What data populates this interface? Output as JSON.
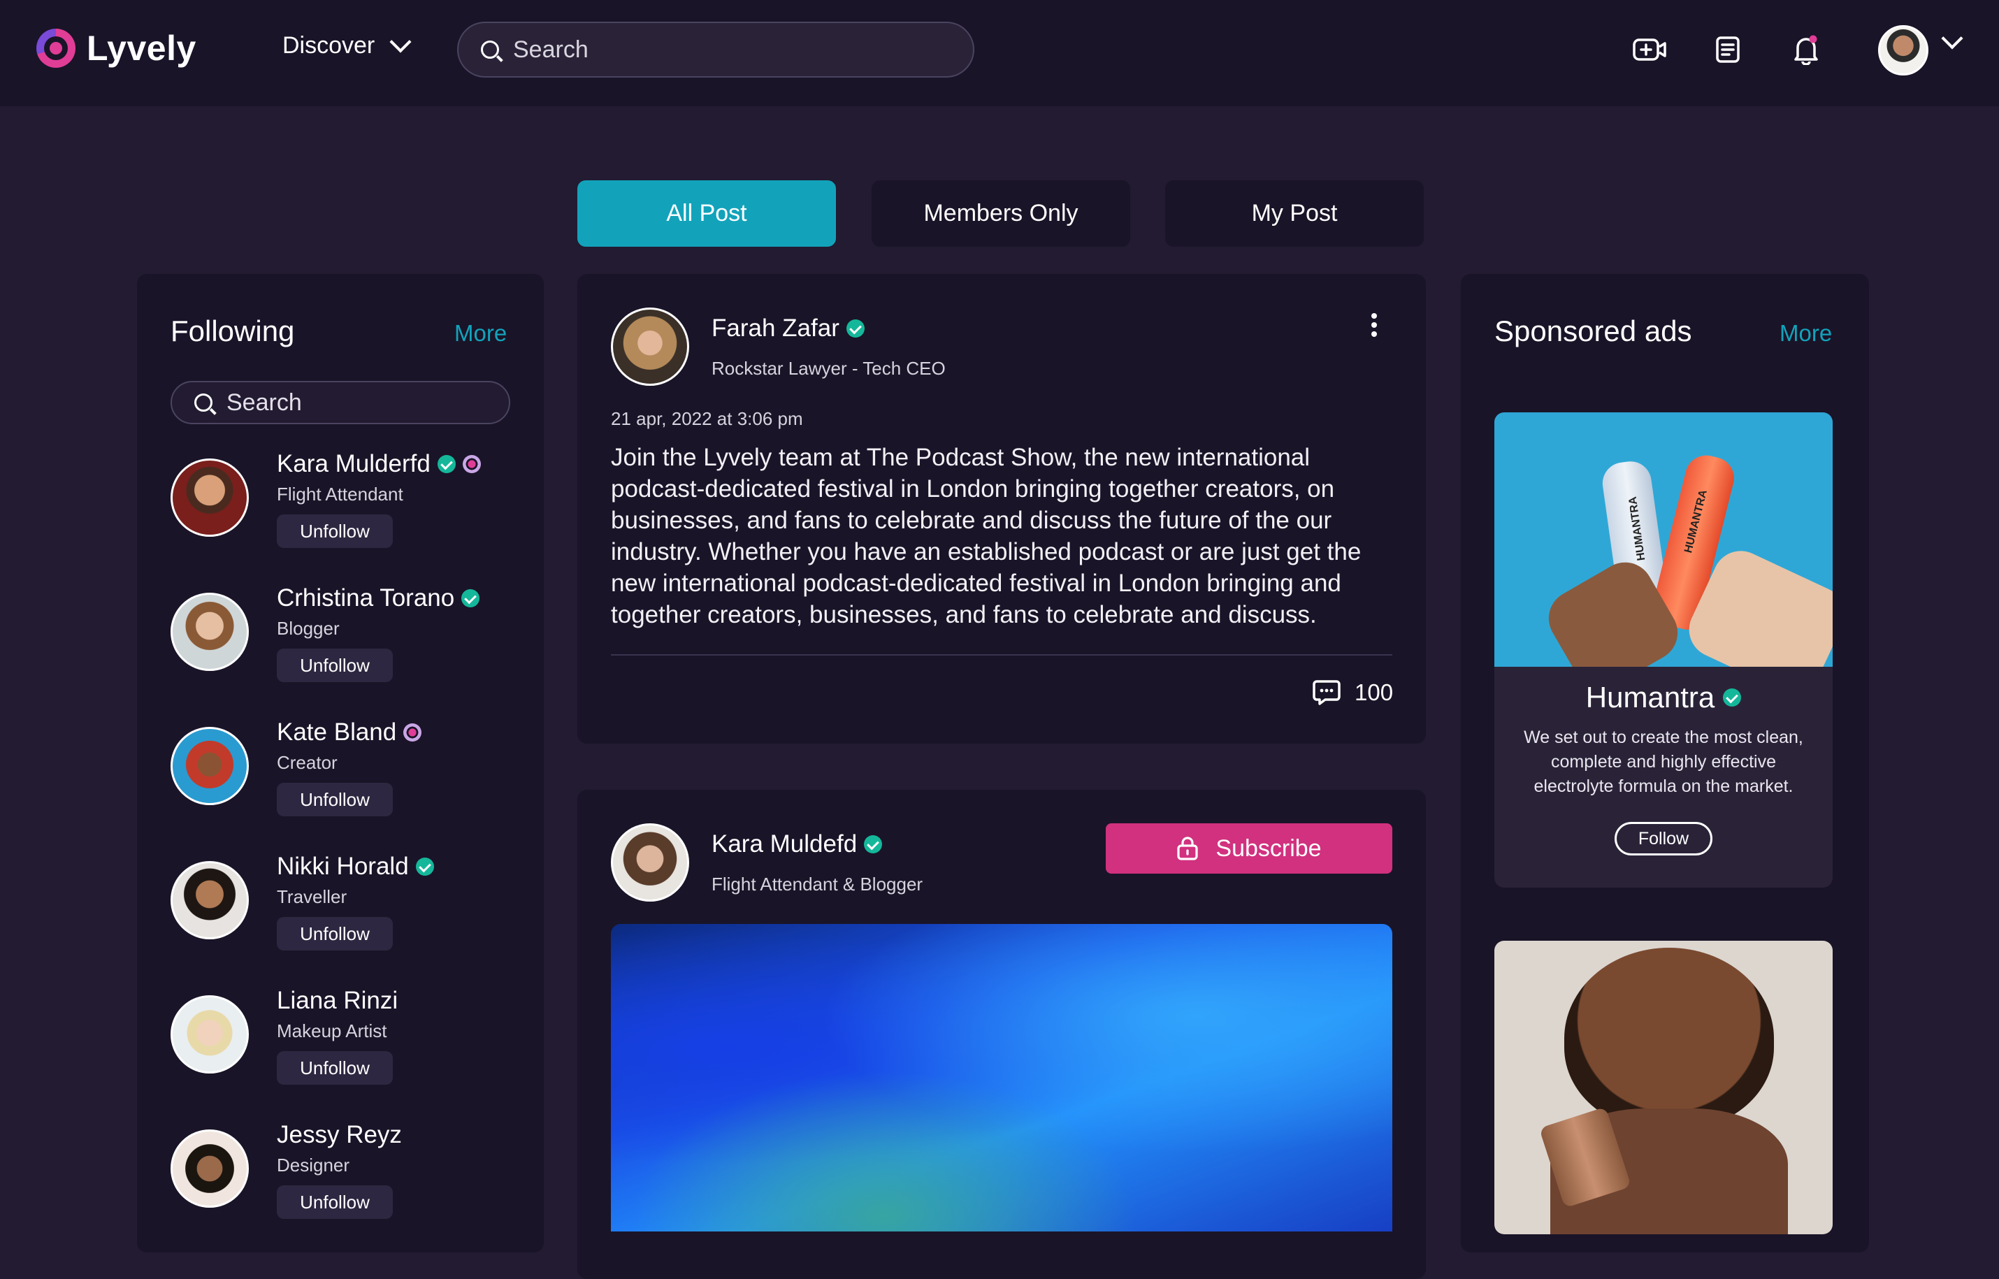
{
  "app": {
    "name": "Lyvely",
    "accent": "#12a3bb",
    "brand": "#e03d97"
  },
  "header": {
    "discover_label": "Discover",
    "search_placeholder": "Search",
    "icons": [
      "add-video-icon",
      "document-icon",
      "bell-icon"
    ],
    "has_notification": true
  },
  "tabs": [
    {
      "label": "All Post",
      "active": true
    },
    {
      "label": "Members Only",
      "active": false
    },
    {
      "label": "My Post",
      "active": false
    }
  ],
  "following": {
    "title": "Following",
    "more": "More",
    "search_placeholder": "Search",
    "unfollow_label": "Unfollow",
    "items": [
      {
        "name": "Kara Mulderfd",
        "role": "Flight Attendant",
        "verified": true,
        "creator": true
      },
      {
        "name": "Crhistina  Torano",
        "role": "Blogger",
        "verified": true,
        "creator": false
      },
      {
        "name": "Kate Bland",
        "role": "Creator",
        "verified": false,
        "creator": true
      },
      {
        "name": "Nikki Horald",
        "role": "Traveller",
        "verified": true,
        "creator": false
      },
      {
        "name": "Liana Rinzi",
        "role": "Makeup Artist",
        "verified": false,
        "creator": false
      },
      {
        "name": "Jessy Reyz",
        "role": "Designer",
        "verified": false,
        "creator": false
      }
    ]
  },
  "posts": [
    {
      "author": "Farah Zafar",
      "role": "Rockstar Lawyer - Tech CEO",
      "date": "21 apr, 2022 at  3:06 pm",
      "body": "Join the Lyvely team at The Podcast Show, the new international podcast-dedicated festival in London bringing together creators, on businesses, and fans to celebrate and discuss the future of the our industry. Whether you have an established podcast or are just get the new international podcast-dedicated festival in London bringing and together creators, businesses, and fans to celebrate and discuss.",
      "comments": "100"
    },
    {
      "author": "Kara Muldefd",
      "role": "Flight Attendant & Blogger",
      "subscribe_label": "Subscribe"
    }
  ],
  "sponsored": {
    "title": "Sponsored ads",
    "more": "More",
    "ads": [
      {
        "name": "Humantra",
        "desc": "We set out to create the most clean, complete and highly effective electrolyte formula on the market.",
        "follow_label": "Follow",
        "bottle_text": "HUMANTRA"
      }
    ]
  }
}
